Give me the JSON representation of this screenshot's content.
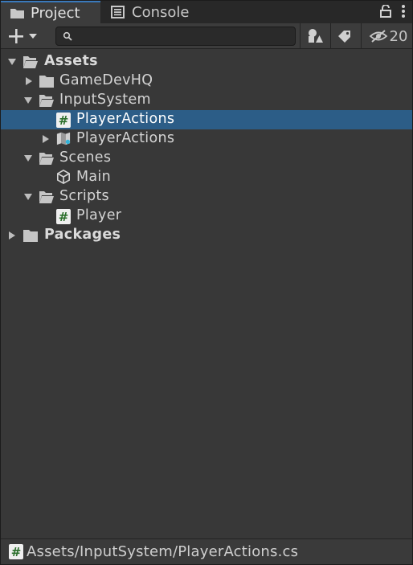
{
  "tabs": [
    {
      "label": "Project",
      "icon": "folder-icon",
      "active": true
    },
    {
      "label": "Console",
      "icon": "console-icon",
      "active": false
    }
  ],
  "toolbar": {
    "add_icon": "plus-icon",
    "search_placeholder": "",
    "hidden_count": "20"
  },
  "tree": [
    {
      "label": "Assets",
      "depth": 0,
      "expanded": true,
      "icon": "folder-open-icon",
      "bold": true
    },
    {
      "label": "GameDevHQ",
      "depth": 1,
      "expanded": false,
      "icon": "folder-icon"
    },
    {
      "label": "InputSystem",
      "depth": 1,
      "expanded": true,
      "icon": "folder-open-icon"
    },
    {
      "label": "PlayerActions",
      "depth": 2,
      "icon": "csharp-script-icon",
      "selected": true
    },
    {
      "label": "PlayerActions",
      "depth": 2,
      "expanded": false,
      "icon": "input-actions-icon"
    },
    {
      "label": "Scenes",
      "depth": 1,
      "expanded": true,
      "icon": "folder-open-icon"
    },
    {
      "label": "Main",
      "depth": 2,
      "icon": "unity-scene-icon"
    },
    {
      "label": "Scripts",
      "depth": 1,
      "expanded": true,
      "icon": "folder-open-icon"
    },
    {
      "label": "Player",
      "depth": 2,
      "icon": "csharp-script-icon"
    },
    {
      "label": "Packages",
      "depth": 0,
      "expanded": false,
      "icon": "folder-icon",
      "bold": true
    }
  ],
  "footer": {
    "path": "Assets/InputSystem/PlayerActions.cs",
    "icon": "csharp-script-icon"
  },
  "colors": {
    "selection": "#2c5d87",
    "tab_accent": "#3a79bb",
    "panel_bg": "#383838"
  }
}
